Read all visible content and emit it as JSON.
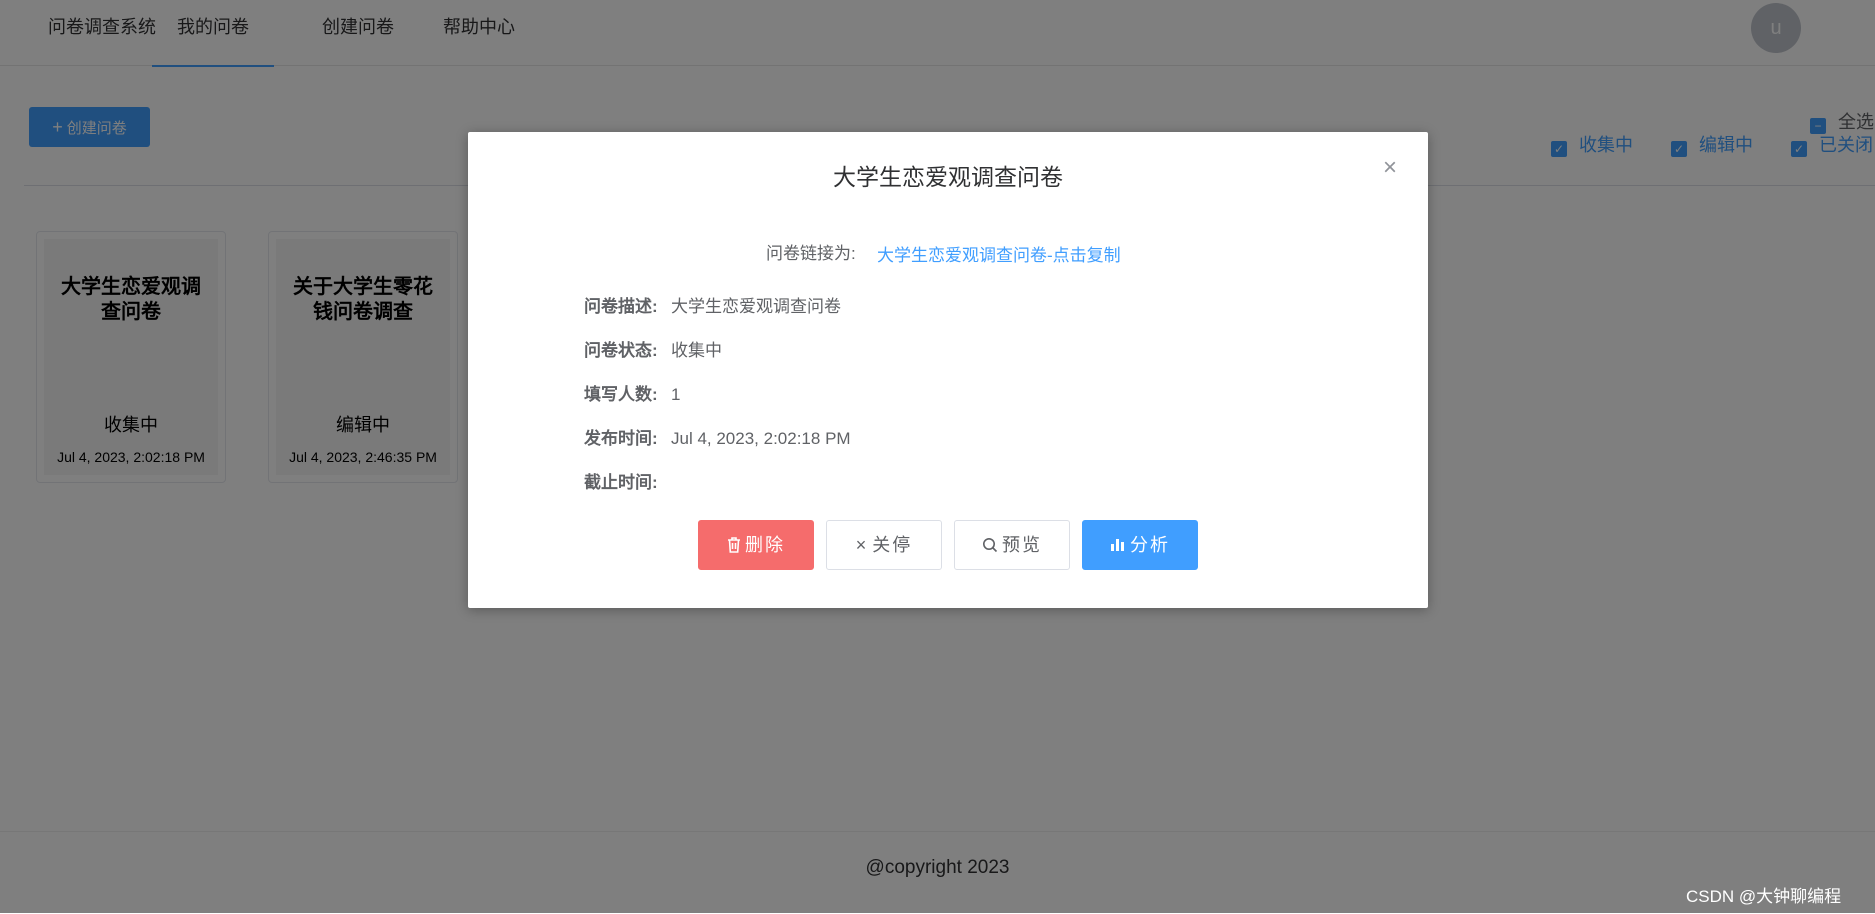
{
  "nav": {
    "items": [
      {
        "label": "问卷调查系统"
      },
      {
        "label": "我的问卷"
      },
      {
        "label": "创建问卷"
      },
      {
        "label": "帮助中心"
      }
    ],
    "avatar_letter": "u"
  },
  "toolbar": {
    "create_label": "创建问卷",
    "select_all_label": "全选",
    "filters": [
      {
        "label": "收集中",
        "checked": true
      },
      {
        "label": "编辑中",
        "checked": true
      },
      {
        "label": "已关闭",
        "checked": true
      }
    ]
  },
  "cards": [
    {
      "title": "大学生恋爱观调查问卷",
      "status": "收集中",
      "time": "Jul 4, 2023, 2:02:18 PM"
    },
    {
      "title": "关于大学生零花钱问卷调查",
      "status": "编辑中",
      "time": "Jul 4, 2023, 2:46:35 PM"
    }
  ],
  "dialog": {
    "title": "大学生恋爱观调查问卷",
    "link_label": "问卷链接为:",
    "link_value": "大学生恋爱观调查问卷-点击复制",
    "fields": [
      {
        "key": "问卷描述:",
        "value": "大学生恋爱观调查问卷"
      },
      {
        "key": "问卷状态:",
        "value": "收集中"
      },
      {
        "key": "填写人数:",
        "value": "1"
      },
      {
        "key": "发布时间:",
        "value": "Jul 4, 2023, 2:02:18 PM"
      },
      {
        "key": "截止时间:",
        "value": ""
      }
    ],
    "buttons": {
      "delete": "删除",
      "close": "关停",
      "preview": "预览",
      "analyze": "分析"
    }
  },
  "footer": {
    "text": "@copyright 2023"
  },
  "watermark": "CSDN @大钟聊编程",
  "colors": {
    "primary": "#409eff",
    "danger": "#f56c6c"
  }
}
